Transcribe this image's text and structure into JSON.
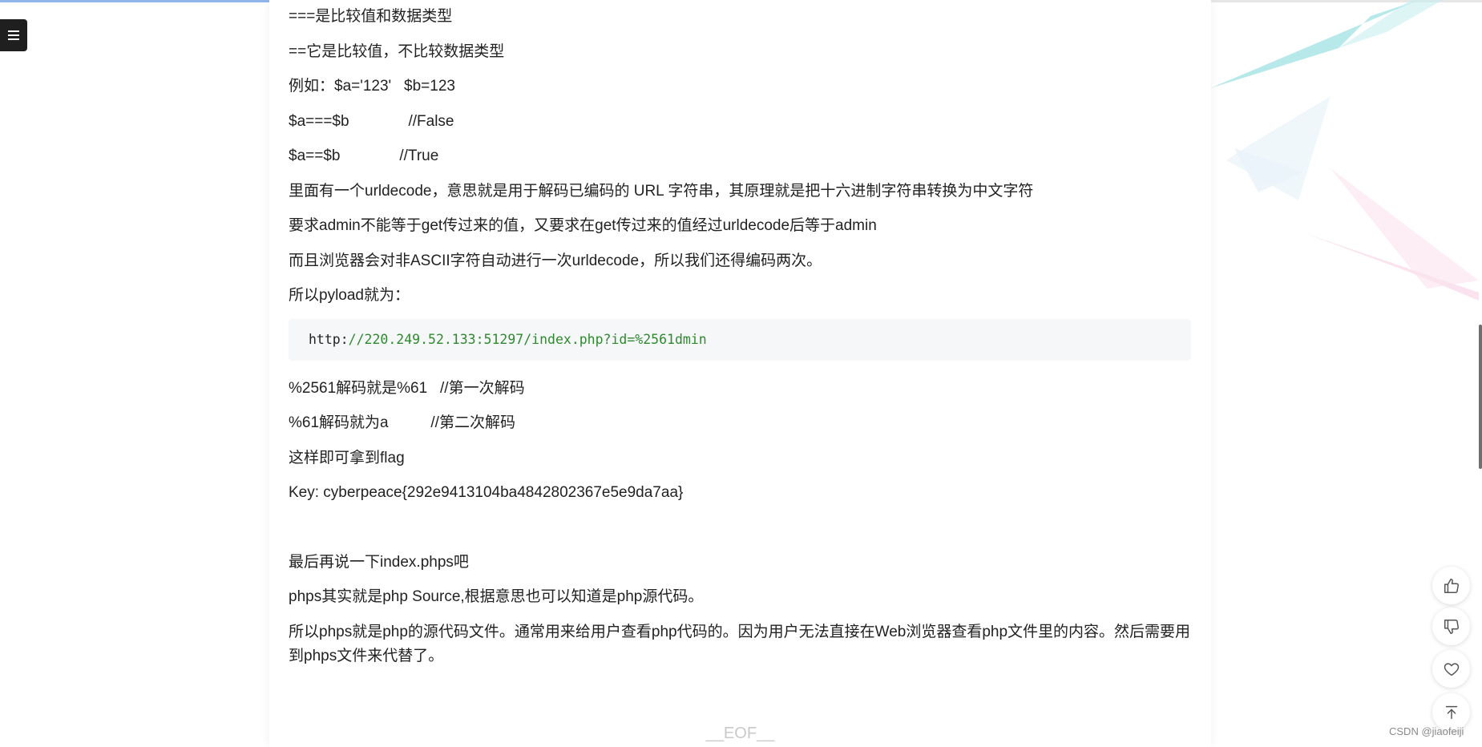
{
  "reading_progress": 0.54,
  "colors": {
    "code_string": "#2f8a2f",
    "progress": "#8fb6ea",
    "eof": "#c9c9c9"
  },
  "menu": {
    "icon": "hamburger-icon"
  },
  "article": {
    "paragraphs_top": [
      "===是比较值和数据类型",
      "==它是比较值，不比较数据类型",
      "例如：$a='123'   $b=123",
      "$a===$b              //False",
      "$a==$b              //True",
      "里面有一个urldecode，意思就是用于解码已编码的 URL 字符串，其原理就是把十六进制字符串转换为中文字符",
      "要求admin不能等于get传过来的值，又要求在get传过来的值经过urldecode后等于admin",
      "而且浏览器会对非ASCII字符自动进行一次urldecode，所以我们还得编码两次。",
      "所以pyload就为："
    ],
    "code": {
      "proto": "http:",
      "rest": "//220.249.52.133:51297/index.php?id=%2561dmin"
    },
    "paragraphs_mid": [
      "%2561解码就是%61   //第一次解码",
      "%61解码就为a          //第二次解码",
      "这样即可拿到flag",
      "Key: cyberpeace{292e9413104ba4842802367e5e9da7aa}"
    ],
    "paragraphs_bottom": [
      "最后再说一下index.phps吧",
      "phps其实就是php Source,根据意思也可以知道是php源代码。",
      "所以phps就是php的源代码文件。通常用来给用户查看php代码的。因为用户无法直接在Web浏览器查看php文件里的内容。然后需要用到phps文件来代替了。"
    ],
    "eof": "__EOF__"
  },
  "actions": [
    {
      "name": "like-button",
      "icon": "thumbs-up-icon"
    },
    {
      "name": "dislike-button",
      "icon": "thumbs-down-icon"
    },
    {
      "name": "favorite-button",
      "icon": "heart-icon"
    },
    {
      "name": "back-to-top-button",
      "icon": "arrow-up-icon"
    }
  ],
  "watermark": "CSDN @jiaofeiji"
}
